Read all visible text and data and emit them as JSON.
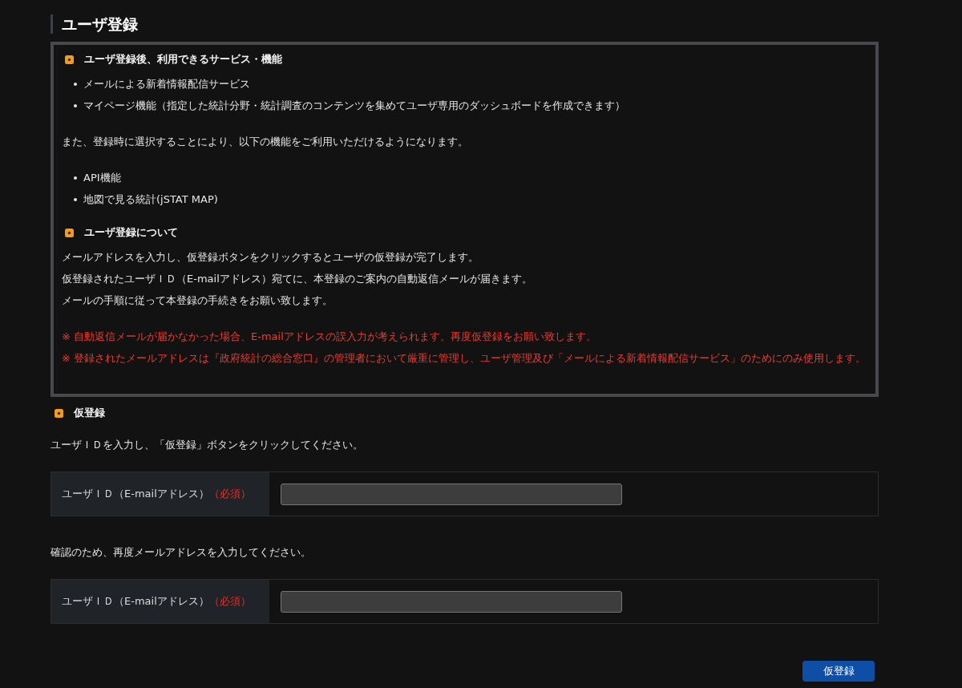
{
  "page_title": "ユーザ登録",
  "info_box": {
    "sections": [
      {
        "heading": "ユーザ登録後、利用できるサービス・機能",
        "blocks": [
          {
            "kind": "bullets",
            "items": [
              "メールによる新着情報配信サービス",
              "マイページ機能（指定した統計分野・統計調査のコンテンツを集めてユーザ専用のダッシュボードを作成できます）"
            ]
          },
          {
            "kind": "lines",
            "items": [
              "また、登録時に選択することにより、以下の機能をご利用いただけるようになります。"
            ]
          },
          {
            "kind": "bullets",
            "items": [
              "API機能",
              "地図で見る統計(jSTAT MAP)"
            ]
          }
        ]
      },
      {
        "heading": "ユーザ登録について",
        "blocks": [
          {
            "kind": "lines",
            "items": [
              "メールアドレスを入力し、仮登録ボタンをクリックするとユーザの仮登録が完了します。",
              "仮登録されたユーザＩＤ（E-mailアドレス）宛てに、本登録のご案内の自動返信メールが届きます。",
              "メールの手順に従って本登録の手続きをお願い致します。"
            ]
          },
          {
            "kind": "notes",
            "items": [
              "※ 自動返信メールが届かなかった場合、E-mailアドレスの誤入力が考えられます。再度仮登録をお願い致します。",
              "※ 登録されたメールアドレスは『政府統計の総合窓口』の管理者において厳重に管理し、ユーザ管理及び「メールによる新着情報配信サービス」のためにのみ使用します。"
            ]
          }
        ]
      }
    ]
  },
  "registration": {
    "heading": "仮登録",
    "fields": [
      {
        "instruction": "ユーザＩＤを入力し、「仮登録」ボタンをクリックしてください。",
        "label": "ユーザＩＤ（E-mailアドレス）",
        "required": "（必須）"
      },
      {
        "instruction": "確認のため、再度メールアドレスを入力してください。",
        "label": "ユーザＩＤ（E-mailアドレス）",
        "required": "（必須）"
      }
    ],
    "submit": "仮登録"
  }
}
